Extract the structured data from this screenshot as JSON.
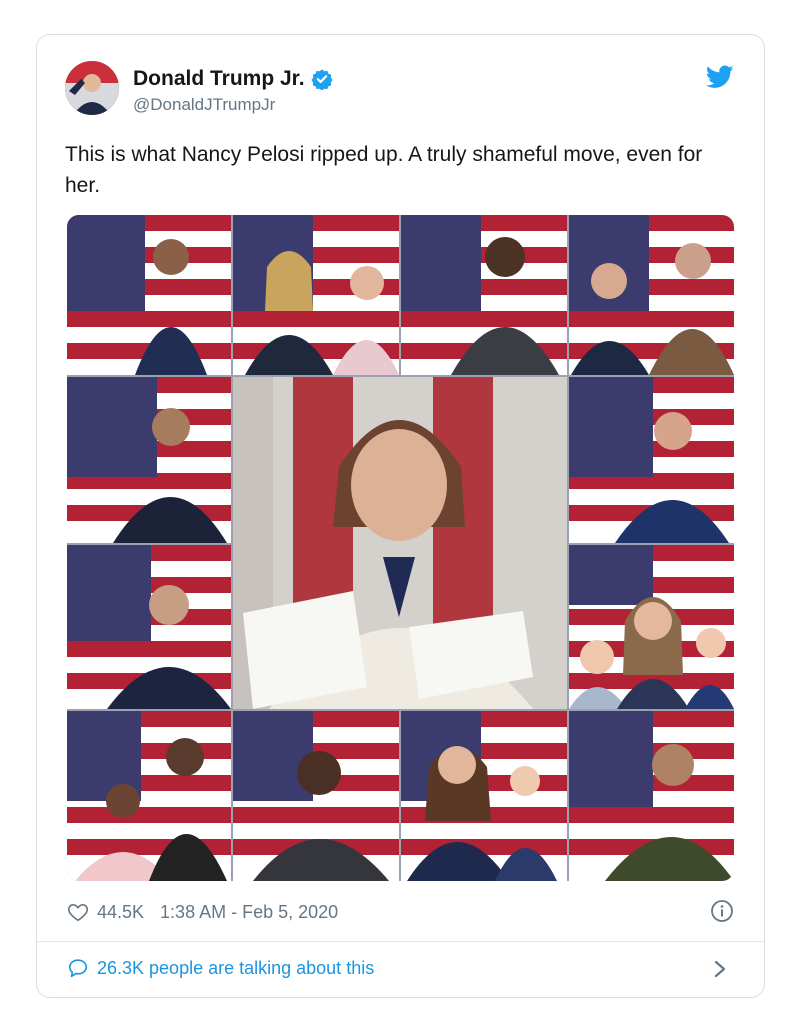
{
  "tweet": {
    "author_name": "Donald Trump Jr.",
    "author_handle": "@DonaldJTrumpJr",
    "text": "This is what Nancy Pelosi ripped up. A truly shameful move, even for her.",
    "likes": "44.5K",
    "timestamp": "1:38 AM - Feb 5, 2020",
    "talking": "26.3K people are talking about this"
  },
  "icons": {
    "verified": "verified-badge-icon",
    "brand": "twitter-bird-icon",
    "like": "heart-icon",
    "info": "info-icon",
    "reply": "speech-bubble-icon",
    "more": "chevron-right-icon"
  },
  "colors": {
    "twitter_blue": "#1da1f2",
    "link_blue": "#1b95e0",
    "muted_text": "#657786",
    "flag_red": "#b22234",
    "flag_blue": "#3c3b6e"
  }
}
